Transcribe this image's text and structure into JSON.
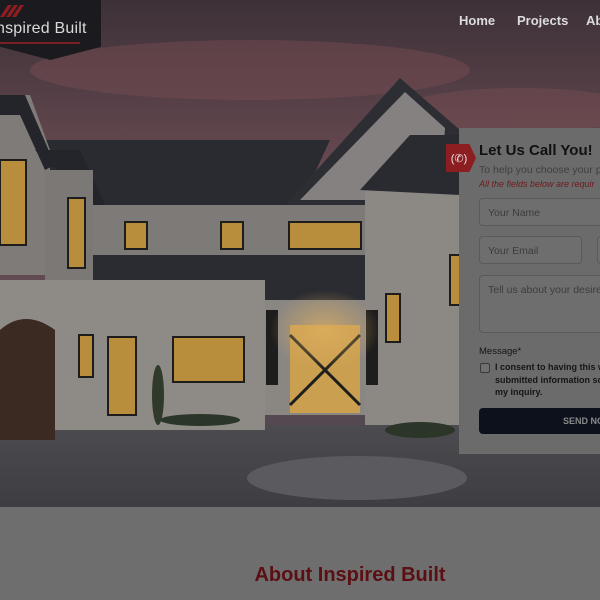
{
  "brand": {
    "name": "nspired Built"
  },
  "nav": {
    "items": [
      {
        "label": "Home"
      },
      {
        "label": "Projects"
      },
      {
        "label": "Ab"
      }
    ]
  },
  "contact_form": {
    "title": "Let Us Call You!",
    "subtitle": "To help you choose your p",
    "required_note": "All the fields below are requir",
    "name_placeholder": "Your Name",
    "email_placeholder": "Your Email",
    "message_placeholder": "Tell us about your desire",
    "message_label": "Message*",
    "consent_text": "I consent to having this w submitted information so my inquiry.",
    "submit_label": "SEND NOV"
  },
  "about": {
    "title": "About Inspired Built"
  },
  "colors": {
    "accent": "#8c1d21",
    "button": "#0c111c",
    "overlay": "#6e6e6e"
  },
  "icons": {
    "logo_mark": "roof-stripes-icon",
    "call": "phone-ringing-icon"
  }
}
